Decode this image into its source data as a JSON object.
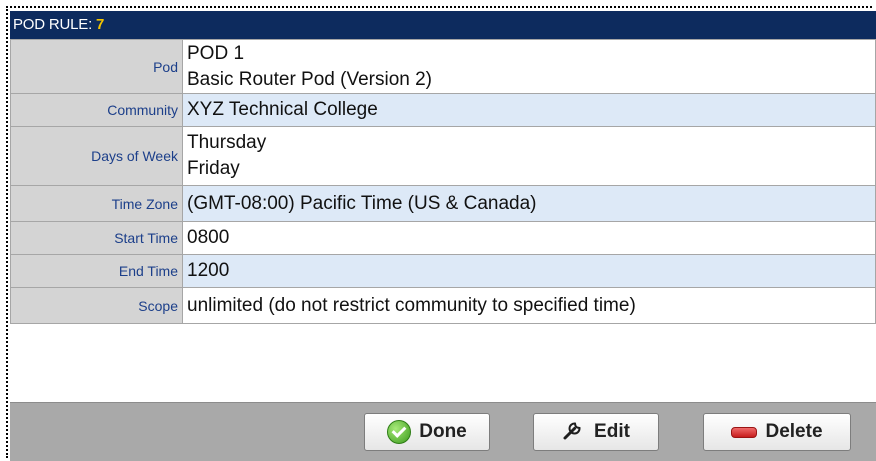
{
  "header": {
    "label": "POD RULE:",
    "number": "7"
  },
  "rows": [
    {
      "label": "Pod",
      "lines": [
        "POD 1",
        "Basic Router Pod (Version 2)"
      ]
    },
    {
      "label": "Community",
      "lines": [
        "XYZ Technical College"
      ]
    },
    {
      "label": "Days of Week",
      "lines": [
        "Thursday",
        "Friday"
      ]
    },
    {
      "label": "Time Zone",
      "lines": [
        "(GMT-08:00) Pacific Time (US & Canada)"
      ]
    },
    {
      "label": "Start Time",
      "lines": [
        "0800"
      ]
    },
    {
      "label": "End Time",
      "lines": [
        "1200"
      ]
    },
    {
      "label": "Scope",
      "lines": [
        "unlimited (do not restrict community to specified time)"
      ]
    }
  ],
  "buttons": {
    "done": "Done",
    "edit": "Edit",
    "delete": "Delete"
  },
  "colors": {
    "header_bg": "#0d2b5e",
    "header_number": "#f3c400",
    "label_bg": "#d4d4d4",
    "alt_row_bg": "#dde9f7",
    "footer_bg": "#a9a9a9"
  },
  "icons": {
    "done": "check-circle-icon",
    "edit": "wrench-icon",
    "delete": "minus-bar-icon"
  }
}
